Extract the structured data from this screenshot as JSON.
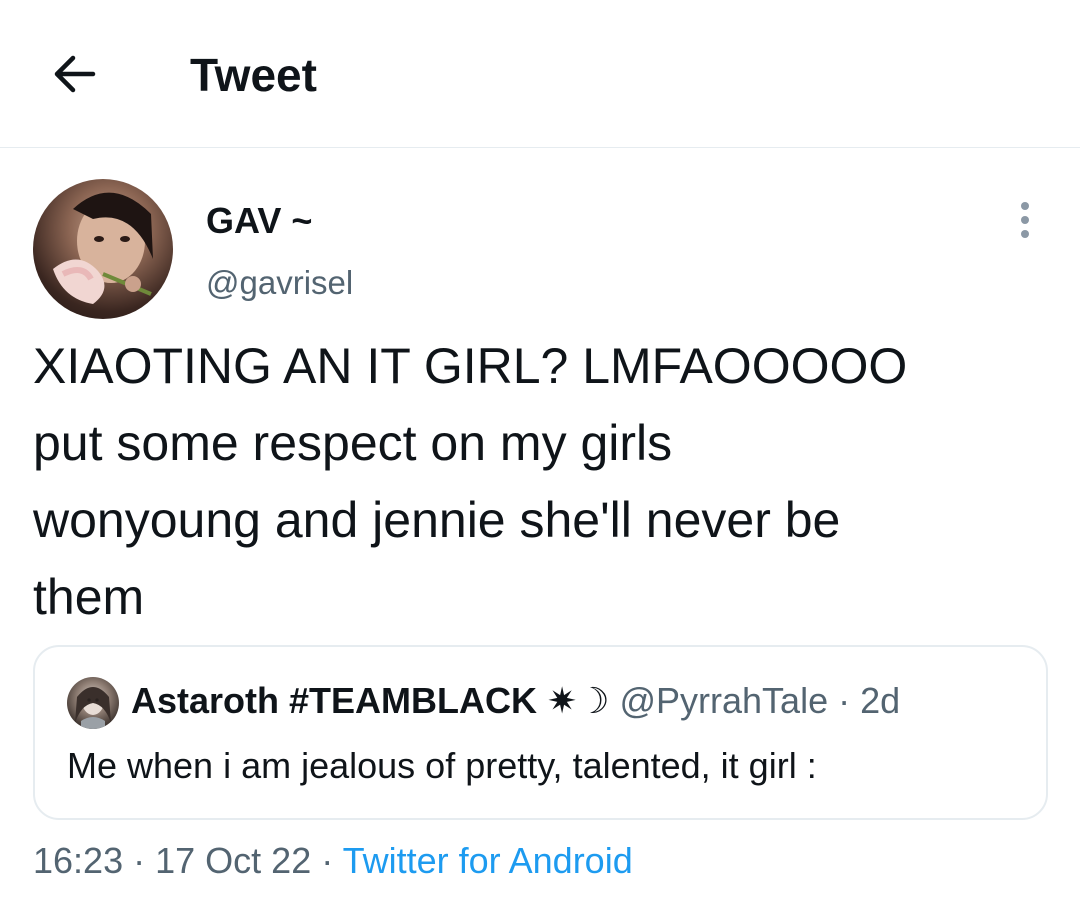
{
  "header": {
    "title": "Tweet",
    "back_icon": "arrow-left-icon"
  },
  "tweet": {
    "author": {
      "display_name": "GAV ~",
      "handle": "@gavrisel"
    },
    "more_icon": "more-vertical-icon",
    "text": "XIAOTING AN IT GIRL? LMFAOOOOO\nput some respect on my girls\nwonyoung and jennie she'll never be\nthem",
    "quoted": {
      "display_name": "Astaroth #TEAMBLACK ✷☽",
      "handle": "@PyrrahTale",
      "separator": "·",
      "age": "2d",
      "text": "Me when i am jealous of pretty, talented, it girl :"
    },
    "time": "16:23",
    "date": "17 Oct 22",
    "separator": "·",
    "source": "Twitter for Android"
  },
  "colors": {
    "text_primary": "#0f1419",
    "text_secondary": "#536471",
    "link": "#1d9bf0",
    "border": "#e6ecf0"
  }
}
